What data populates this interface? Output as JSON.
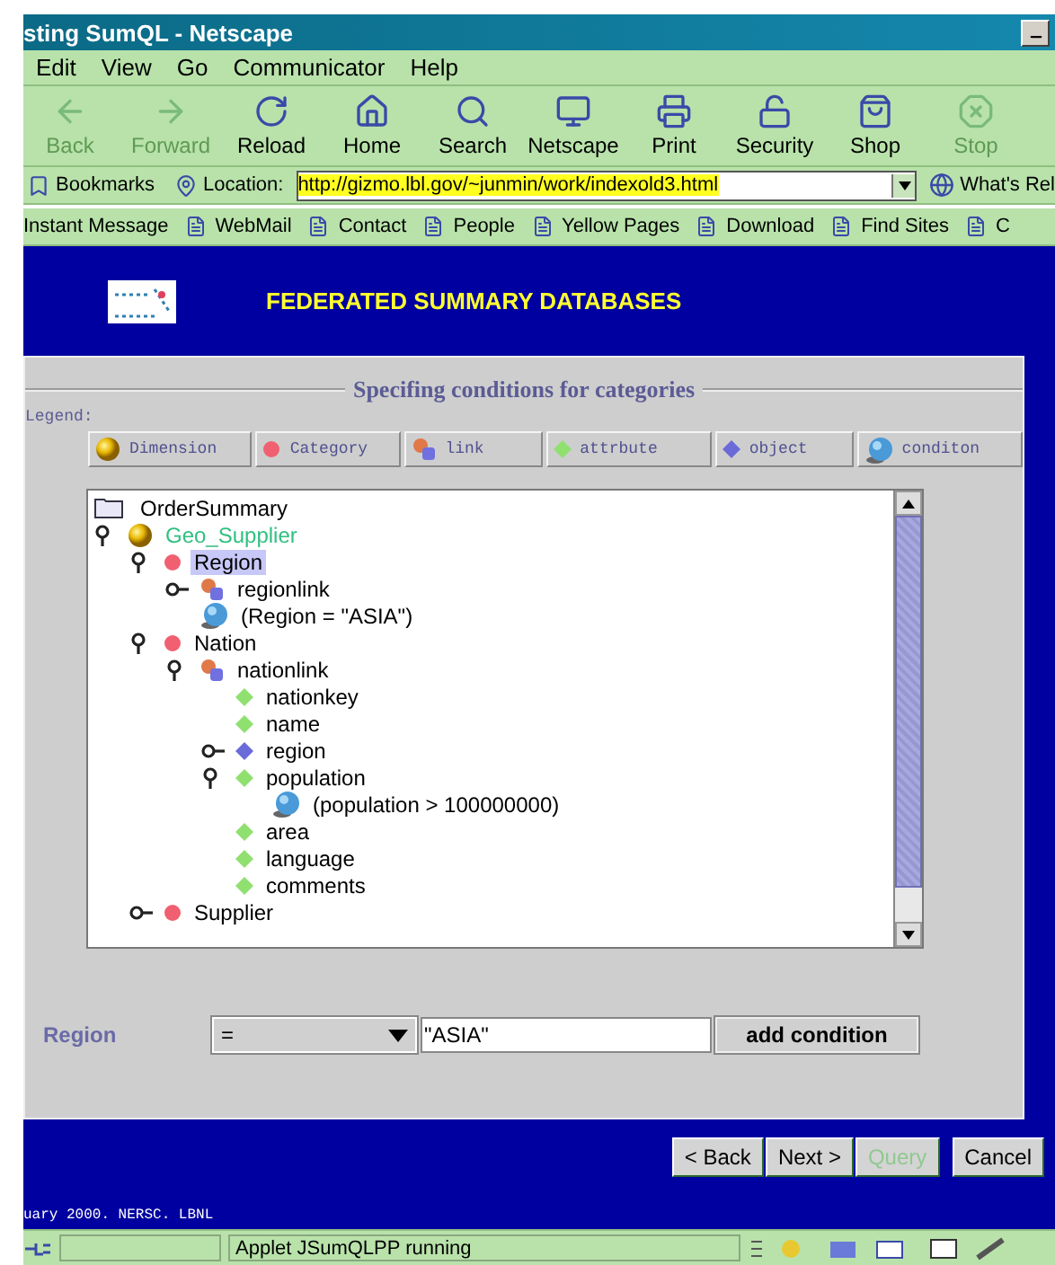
{
  "window": {
    "title": "sting SumQL - Netscape"
  },
  "menu": [
    "Edit",
    "View",
    "Go",
    "Communicator",
    "Help"
  ],
  "toolbar": [
    {
      "label": "Back",
      "disabled": true
    },
    {
      "label": "Forward",
      "disabled": true
    },
    {
      "label": "Reload",
      "disabled": false
    },
    {
      "label": "Home",
      "disabled": false
    },
    {
      "label": "Search",
      "disabled": false
    },
    {
      "label": "Netscape",
      "disabled": false
    },
    {
      "label": "Print",
      "disabled": false
    },
    {
      "label": "Security",
      "disabled": false
    },
    {
      "label": "Shop",
      "disabled": false
    },
    {
      "label": "Stop",
      "disabled": true
    }
  ],
  "location_bar": {
    "bookmarks": "Bookmarks",
    "label": "Location:",
    "url": "http://gizmo.lbl.gov/~junmin/work/indexold3.html",
    "related": "What's Rel"
  },
  "personal_toolbar": [
    "Instant Message",
    "WebMail",
    "Contact",
    "People",
    "Yellow Pages",
    "Download",
    "Find Sites",
    "C"
  ],
  "page": {
    "title": "FEDERATED SUMMARY DATABASES",
    "section_title": "Specifing conditions for categories",
    "legend_label": "Legend:",
    "legend": [
      {
        "kind": "dimension",
        "label": "Dimension"
      },
      {
        "kind": "category",
        "label": "Category"
      },
      {
        "kind": "link",
        "label": "link"
      },
      {
        "kind": "attribute",
        "label": "attrbute"
      },
      {
        "kind": "object",
        "label": "object"
      },
      {
        "kind": "condition",
        "label": "conditon"
      }
    ],
    "tree": {
      "kind": "folder",
      "label": "OrderSummary",
      "selected": false,
      "children": [
        {
          "kind": "dimension",
          "label": "Geo_Supplier",
          "selected": false,
          "expanded": true,
          "children": [
            {
              "kind": "category",
              "label": "Region",
              "selected": true,
              "expanded": true,
              "children": [
                {
                  "kind": "link",
                  "label": "regionlink",
                  "selected": false,
                  "expanded": false
                },
                {
                  "kind": "condition",
                  "label": "(Region = \"ASIA\")",
                  "selected": false
                }
              ]
            },
            {
              "kind": "category",
              "label": "Nation",
              "selected": false,
              "expanded": true,
              "children": [
                {
                  "kind": "link",
                  "label": "nationlink",
                  "selected": false,
                  "expanded": true,
                  "children": [
                    {
                      "kind": "attribute",
                      "label": "nationkey",
                      "selected": false
                    },
                    {
                      "kind": "attribute",
                      "label": "name",
                      "selected": false
                    },
                    {
                      "kind": "object",
                      "label": "region",
                      "selected": false,
                      "expanded": false
                    },
                    {
                      "kind": "attribute",
                      "label": "population",
                      "selected": false,
                      "expanded": true,
                      "children": [
                        {
                          "kind": "condition",
                          "label": "(population > 100000000)",
                          "selected": false
                        }
                      ]
                    },
                    {
                      "kind": "attribute",
                      "label": "area",
                      "selected": false
                    },
                    {
                      "kind": "attribute",
                      "label": "language",
                      "selected": false
                    },
                    {
                      "kind": "attribute",
                      "label": "comments",
                      "selected": false
                    }
                  ]
                }
              ]
            },
            {
              "kind": "category",
              "label": "Supplier",
              "selected": false,
              "expanded": false
            }
          ]
        }
      ]
    },
    "condition": {
      "field_label": "Region",
      "operator": "=",
      "value": "\"ASIA\"",
      "button": "add condition"
    },
    "buttons": [
      {
        "label": "< Back",
        "disabled": false
      },
      {
        "label": "Next >",
        "disabled": false
      },
      {
        "label": "Query",
        "disabled": true
      },
      {
        "label": "Cancel",
        "disabled": false
      }
    ],
    "footer": "uary 2000. NERSC. LBNL"
  },
  "status_bar": {
    "text": "Applet JSumQLPP running"
  }
}
